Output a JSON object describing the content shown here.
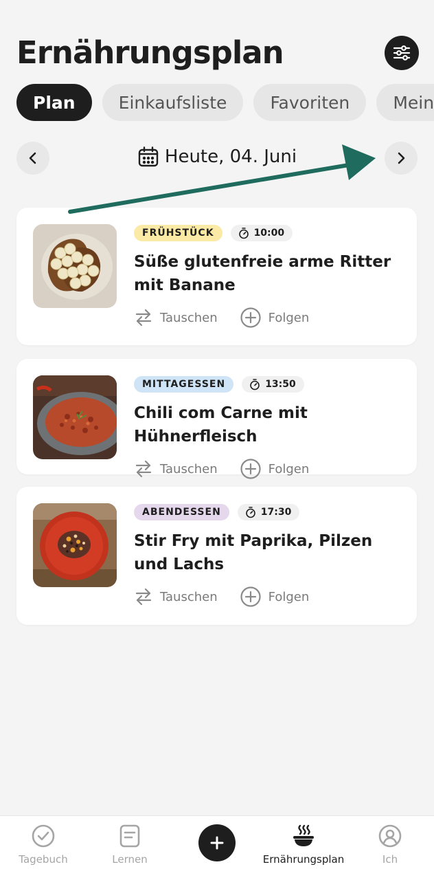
{
  "header": {
    "title": "Ernährungsplan",
    "filter_icon": "sliders-icon"
  },
  "tabs": [
    {
      "label": "Plan",
      "active": true
    },
    {
      "label": "Einkaufsliste",
      "active": false
    },
    {
      "label": "Favoriten",
      "active": false
    },
    {
      "label": "Mein",
      "active": false
    }
  ],
  "date_nav": {
    "label": "Heute, 04. Juni",
    "prev_icon": "chevron-left-icon",
    "next_icon": "chevron-right-icon",
    "calendar_icon": "calendar-icon"
  },
  "meals": [
    {
      "category": "FRÜHSTÜCK",
      "category_color": "#fbeaa6",
      "time": "10:00",
      "title": "Süße glutenfreie arme Ritter mit Banane",
      "swap_label": "Tauschen",
      "follow_label": "Folgen"
    },
    {
      "category": "MITTAGESSEN",
      "category_color": "#cfe4f7",
      "time": "13:50",
      "title": "Chili com Carne mit Hühnerfleisch",
      "swap_label": "Tauschen",
      "follow_label": "Folgen"
    },
    {
      "category": "ABENDESSEN",
      "category_color": "#e6d8ec",
      "time": "17:30",
      "title": "Stir Fry mit Paprika, Pilzen und Lachs",
      "swap_label": "Tauschen",
      "follow_label": "Folgen"
    }
  ],
  "bottom_nav": {
    "items": [
      {
        "label": "Tagebuch",
        "icon": "check-circle-icon",
        "active": false
      },
      {
        "label": "Lernen",
        "icon": "document-icon",
        "active": false
      },
      {
        "label": "Ernährungsplan",
        "icon": "bowl-icon",
        "active": true
      },
      {
        "label": "Ich",
        "icon": "user-icon",
        "active": false
      }
    ],
    "add_icon": "plus-icon"
  },
  "colors": {
    "primary": "#1e1e1e",
    "background": "#f4f4f4",
    "annotation_arrow": "#1f6b5d"
  }
}
